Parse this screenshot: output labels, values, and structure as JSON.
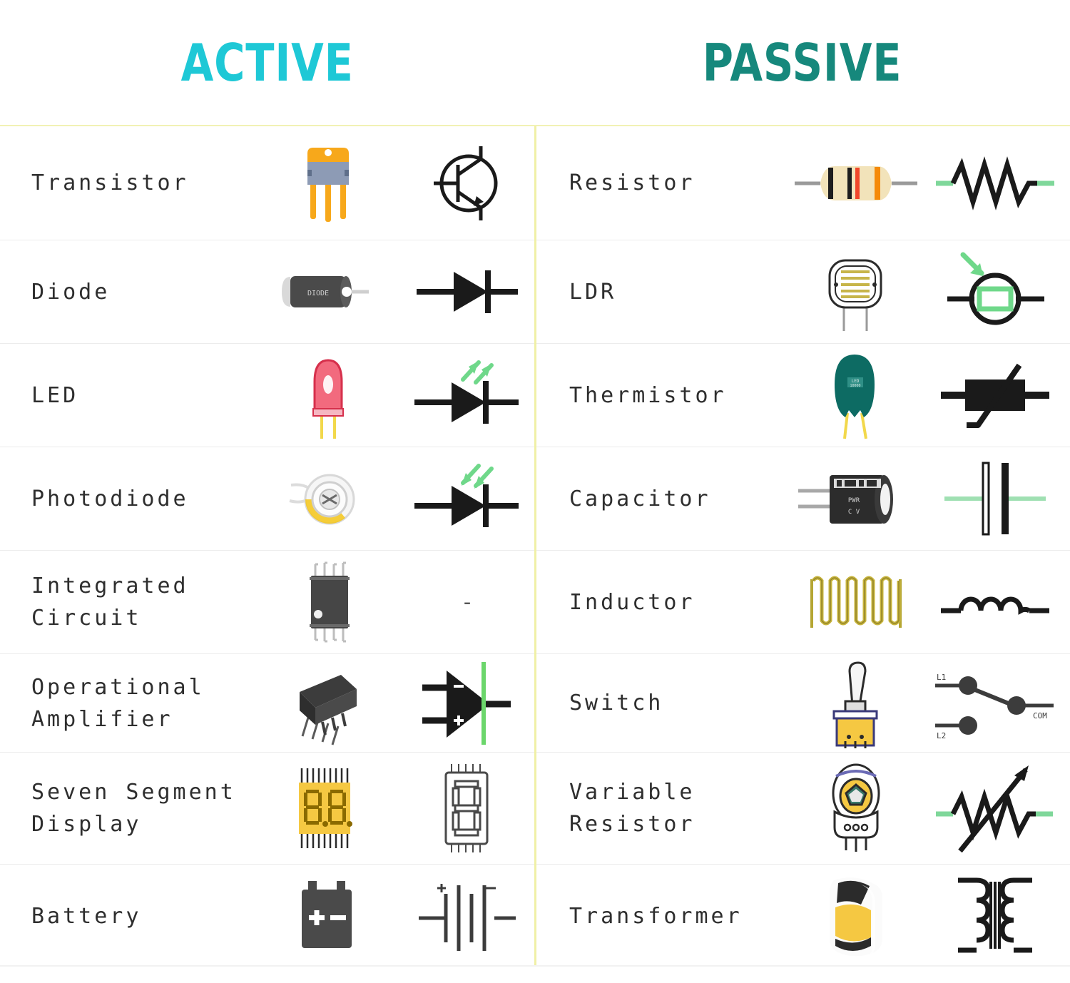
{
  "headers": {
    "left": {
      "label": "ACTIVE",
      "color": "#1ec8d6"
    },
    "right": {
      "label": "PASSIVE",
      "color": "#16887c"
    }
  },
  "colors": {
    "divider_vertical": "#f0f0a6",
    "divider_row": "#ececec",
    "label_text": "#2e2e2e",
    "symbol_black": "#1a1a1a",
    "accent_green": "#6fd88a",
    "lead_green": "#7fd79a"
  },
  "active_column": {
    "title": "ACTIVE",
    "rows": [
      {
        "label": "Transistor",
        "photo_icon": "transistor-to220-photo",
        "symbol_icon": "bjt-npn-symbol",
        "symbol_text": ""
      },
      {
        "label": "Diode",
        "photo_icon": "diode-package-photo",
        "symbol_icon": "diode-symbol",
        "symbol_text": ""
      },
      {
        "label": "LED",
        "photo_icon": "led-red-photo",
        "symbol_icon": "led-symbol",
        "symbol_text": ""
      },
      {
        "label": "Photodiode",
        "photo_icon": "photodiode-photo",
        "symbol_icon": "photodiode-symbol",
        "symbol_text": ""
      },
      {
        "label": "Integrated Circuit",
        "photo_icon": "ic-soic-photo",
        "symbol_icon": "none",
        "symbol_text": "-"
      },
      {
        "label": "Operational Amplifier",
        "photo_icon": "opamp-dip-photo",
        "symbol_icon": "opamp-symbol",
        "symbol_text": ""
      },
      {
        "label": "Seven Segment Display",
        "photo_icon": "seven-segment-photo",
        "symbol_icon": "seven-segment-symbol",
        "symbol_text": ""
      },
      {
        "label": "Battery",
        "photo_icon": "battery-photo",
        "symbol_icon": "battery-symbol",
        "symbol_text": ""
      }
    ]
  },
  "passive_column": {
    "title": "PASSIVE",
    "rows": [
      {
        "label": "Resistor",
        "photo_icon": "resistor-axial-photo",
        "symbol_icon": "resistor-zigzag-symbol",
        "symbol_text": ""
      },
      {
        "label": "LDR",
        "photo_icon": "ldr-photo",
        "symbol_icon": "ldr-symbol",
        "symbol_text": ""
      },
      {
        "label": "Thermistor",
        "photo_icon": "thermistor-disc-photo",
        "symbol_icon": "thermistor-symbol",
        "symbol_text": ""
      },
      {
        "label": "Capacitor",
        "photo_icon": "electrolytic-capacitor-photo",
        "symbol_icon": "capacitor-symbol",
        "symbol_text": ""
      },
      {
        "label": "Inductor",
        "photo_icon": "inductor-coil-photo",
        "symbol_icon": "inductor-symbol",
        "symbol_text": ""
      },
      {
        "label": "Switch",
        "photo_icon": "toggle-switch-photo",
        "symbol_icon": "spdt-switch-symbol",
        "symbol_text": ""
      },
      {
        "label": "Variable Resistor",
        "photo_icon": "potentiometer-photo",
        "symbol_icon": "variable-resistor-symbol",
        "symbol_text": ""
      },
      {
        "label": "Transformer",
        "photo_icon": "transformer-photo",
        "symbol_icon": "transformer-symbol",
        "symbol_text": ""
      }
    ]
  },
  "switch_symbol_labels": {
    "l1": "L1",
    "l2": "L2",
    "com": "COM"
  },
  "seven_segment_photo_text": "8.8.",
  "diode_photo_text": "DIODE"
}
